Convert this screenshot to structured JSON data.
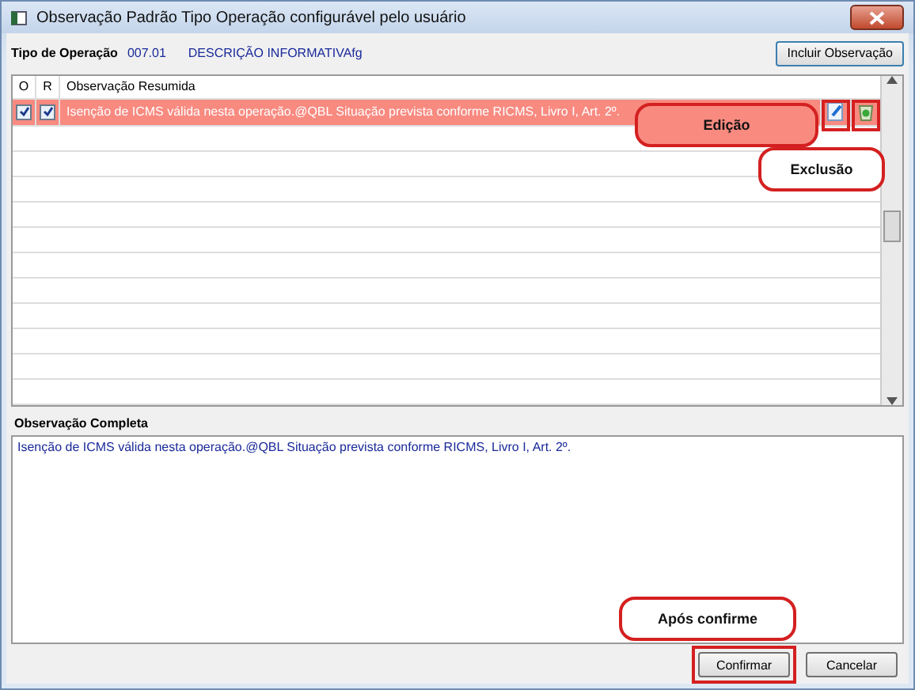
{
  "window": {
    "title": "Observação Padrão Tipo Operação configurável pelo usuário"
  },
  "operation": {
    "label": "Tipo de Operação",
    "code": "007.01",
    "description": "DESCRIÇÃO INFORMATIVAfg"
  },
  "include_button": "Incluir Observação",
  "grid": {
    "columns": [
      "O",
      "R",
      "Observação Resumida"
    ],
    "rows": [
      {
        "o_checked": true,
        "r_checked": true,
        "text": "Isenção de ICMS válida nesta operação.@QBL Situação prevista conforme RICMS, Livro I, Art. 2º.",
        "selected": true
      }
    ]
  },
  "full_observation": {
    "label": "Observação Completa",
    "text": "Isenção de ICMS válida nesta operação.@QBL Situação prevista conforme RICMS, Livro I, Art. 2º."
  },
  "buttons": [
    {
      "label": "Confirmar",
      "highlighted": true
    },
    {
      "label": "Cancelar",
      "highlighted": false
    }
  ],
  "callouts": [
    {
      "text": "Edição"
    },
    {
      "text": "Exclusão"
    },
    {
      "text": "Após confirme"
    }
  ]
}
